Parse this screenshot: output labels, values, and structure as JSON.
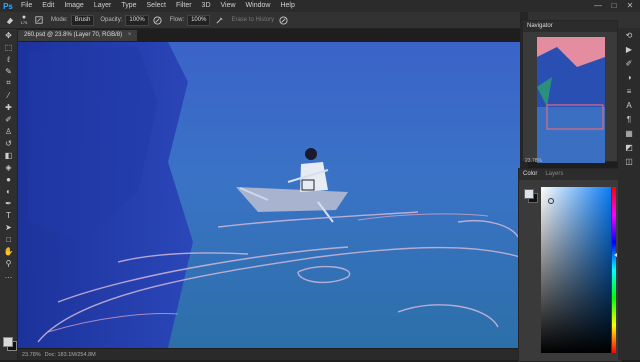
{
  "app": {
    "logo": "Ps"
  },
  "menu": [
    "File",
    "Edit",
    "Image",
    "Layer",
    "Type",
    "Select",
    "Filter",
    "3D",
    "View",
    "Window",
    "Help"
  ],
  "window_controls": [
    "—",
    "□",
    "✕"
  ],
  "options": {
    "brush_size": "175",
    "mode_label": "Mode:",
    "mode_value": "Brush",
    "opacity_label": "Opacity:",
    "opacity_value": "100%",
    "flow_label": "Flow:",
    "flow_value": "100%",
    "erase_history": "Erase to History"
  },
  "document": {
    "tab_title": "260.psd @ 23.8% (Layer 70, RGB/8)",
    "close": "×"
  },
  "status": {
    "zoom": "23.78%",
    "doc": "Doc: 183.1M/254.8M"
  },
  "navigator": {
    "title": "Navigator",
    "zoom": "23.78%"
  },
  "color_panel": {
    "tabs": [
      "Color",
      "Layers"
    ]
  },
  "colors": {
    "fg": "#dde4ee",
    "bg": "#111111",
    "hue": "#0a7cf5"
  },
  "tools": [
    "move-icon",
    "marquee-icon",
    "lasso-icon",
    "quick-select-icon",
    "crop-icon",
    "eyedropper-icon",
    "healing-icon",
    "brush-icon",
    "stamp-icon",
    "history-brush-icon",
    "eraser-icon",
    "bucket-icon",
    "blur-icon",
    "dodge-icon",
    "pen-icon",
    "type-icon",
    "path-select-icon",
    "shape-icon",
    "hand-icon",
    "zoom-icon"
  ]
}
